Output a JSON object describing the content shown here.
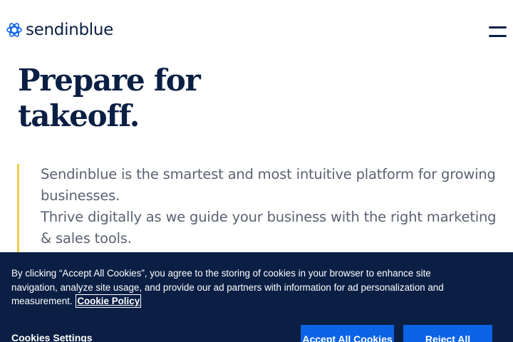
{
  "header": {
    "logo_text": "sendinblue",
    "menu_icon": "hamburger-menu-icon"
  },
  "hero": {
    "title_line1": "Prepare for",
    "title_line2": "takeoff."
  },
  "intro": {
    "line1": "Sendinblue is the smartest and most intuitive platform for growing businesses.",
    "line2": "Thrive digitally as we guide your business with the right marketing & sales tools."
  },
  "cookie_banner": {
    "text": "By clicking “Accept All Cookies”, you agree to the storing of cookies in your browser to enhance site navigation, analyze site usage, and provide our ad partners with information for ad personalization and measurement.",
    "policy_link": "Cookie Policy",
    "settings_label": "Cookies Settings",
    "accept_label": "Accept All Cookies",
    "reject_label": "Reject All"
  },
  "colors": {
    "brand_navy": "#0b1f44",
    "accent_yellow": "#f2c94c",
    "button_blue": "#0b63e5",
    "body_text_gray": "#5b6270"
  }
}
